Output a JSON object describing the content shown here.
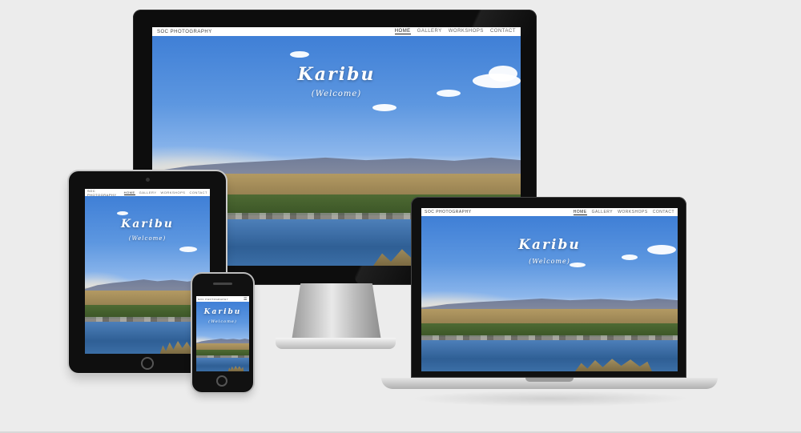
{
  "site": {
    "brand": "SOC PHOTOGRAPHY",
    "nav": [
      "HOME",
      "GALLERY",
      "WORKSHOPS",
      "CONTACT"
    ],
    "active_nav": "HOME",
    "hero_title": "Karibu",
    "hero_subtitle": "(Welcome)"
  },
  "devices": [
    "desktop-monitor",
    "tablet",
    "laptop",
    "phone"
  ],
  "colors": {
    "background": "#ececec",
    "sky": "#4a88dc",
    "bezel": "#0d0d0d",
    "nav_bg": "#ffffff"
  }
}
